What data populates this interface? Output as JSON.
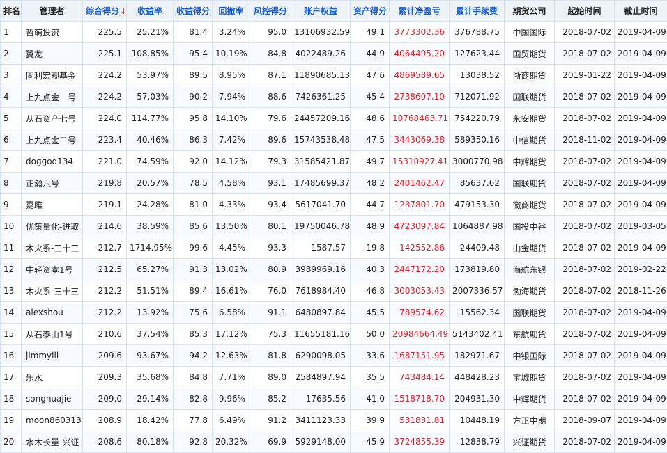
{
  "headers": [
    {
      "label": "排名",
      "sortable": false
    },
    {
      "label": "管理者",
      "sortable": false
    },
    {
      "label": "综合得分",
      "sortable": true,
      "sort_indicator": "↓"
    },
    {
      "label": "收益率",
      "sortable": true
    },
    {
      "label": "收益得分",
      "sortable": true
    },
    {
      "label": "回撤率",
      "sortable": true
    },
    {
      "label": "风控得分",
      "sortable": true
    },
    {
      "label": "账户权益",
      "sortable": true
    },
    {
      "label": "资产得分",
      "sortable": true
    },
    {
      "label": "累计净盈亏",
      "sortable": true
    },
    {
      "label": "累计手续费",
      "sortable": true
    },
    {
      "label": "期货公司",
      "sortable": false
    },
    {
      "label": "起始时间",
      "sortable": false
    },
    {
      "label": "截止时间",
      "sortable": false
    }
  ],
  "rows": [
    [
      "1",
      "哲萌投资",
      "225.5",
      "25.21%",
      "81.4",
      "3.24%",
      "95.0",
      "13106932.59",
      "49.1",
      "3773302.36",
      "376788.75",
      "中国国际",
      "2018-07-02",
      "2019-04-09"
    ],
    [
      "2",
      "翼龙",
      "225.1",
      "108.85%",
      "95.4",
      "10.19%",
      "84.8",
      "4022489.26",
      "44.9",
      "4064495.20",
      "127623.44",
      "国贸期货",
      "2018-07-02",
      "2019-04-09"
    ],
    [
      "3",
      "固利宏观基金",
      "224.2",
      "53.97%",
      "89.5",
      "8.95%",
      "87.1",
      "11890685.13",
      "47.6",
      "4869589.65",
      "13038.52",
      "浙商期货",
      "2019-01-22",
      "2019-04-09"
    ],
    [
      "4",
      "上九点金一号",
      "224.2",
      "57.03%",
      "90.2",
      "7.94%",
      "88.6",
      "7426361.25",
      "45.4",
      "2738697.10",
      "712071.92",
      "国联期货",
      "2018-07-02",
      "2019-04-09"
    ],
    [
      "5",
      "从石资产七号",
      "224.0",
      "114.77%",
      "95.8",
      "14.10%",
      "79.6",
      "24457209.16",
      "48.6",
      "10768463.71",
      "754220.79",
      "永安期货",
      "2018-07-02",
      "2019-04-09"
    ],
    [
      "6",
      "上九点金二号",
      "223.4",
      "40.46%",
      "86.3",
      "7.42%",
      "89.6",
      "15743538.48",
      "47.5",
      "3443069.38",
      "589350.16",
      "中信期货",
      "2018-11-02",
      "2019-04-09"
    ],
    [
      "7",
      "doggod134",
      "221.0",
      "74.59%",
      "92.0",
      "14.12%",
      "79.3",
      "31585421.87",
      "49.7",
      "15310927.41",
      "3000770.98",
      "中辉期货",
      "2018-07-02",
      "2019-04-09"
    ],
    [
      "8",
      "正瀚六号",
      "219.8",
      "20.57%",
      "78.5",
      "4.58%",
      "93.1",
      "17485699.37",
      "48.2",
      "2401462.47",
      "85637.62",
      "国联期货",
      "2018-07-02",
      "2019-04-09"
    ],
    [
      "9",
      "嘉雎",
      "219.1",
      "24.28%",
      "81.0",
      "4.33%",
      "93.4",
      "5617041.70",
      "44.7",
      "1237801.70",
      "479153.30",
      "徽商期货",
      "2018-07-02",
      "2019-04-09"
    ],
    [
      "10",
      "优策量化-进取",
      "214.6",
      "38.59%",
      "85.6",
      "13.50%",
      "80.1",
      "19750046.78",
      "48.9",
      "4723097.84",
      "1064887.98",
      "国投中谷",
      "2018-07-02",
      "2019-03-05"
    ],
    [
      "11",
      "木火系-三十三",
      "212.7",
      "1714.95%",
      "99.6",
      "4.45%",
      "93.3",
      "1587.57",
      "19.8",
      "142552.86",
      "24409.48",
      "山金期货",
      "2018-07-02",
      "2019-04-09"
    ],
    [
      "12",
      "中轻资本1号",
      "212.5",
      "65.27%",
      "91.3",
      "13.02%",
      "80.9",
      "3989969.16",
      "40.3",
      "2447172.20",
      "173819.80",
      "海航东银",
      "2018-07-02",
      "2019-02-22"
    ],
    [
      "13",
      "木火系-三十三",
      "212.2",
      "51.51%",
      "89.4",
      "16.61%",
      "76.0",
      "7618984.40",
      "46.8",
      "3003053.43",
      "2007336.57",
      "渤海期货",
      "2018-07-02",
      "2018-11-26"
    ],
    [
      "14",
      "alexshou",
      "212.2",
      "13.92%",
      "75.6",
      "6.58%",
      "91.1",
      "6480897.84",
      "45.5",
      "789574.62",
      "15562.34",
      "国联期货",
      "2018-07-02",
      "2019-04-09"
    ],
    [
      "15",
      "从石泰山1号",
      "210.6",
      "37.54%",
      "85.3",
      "17.12%",
      "75.3",
      "11655181.16",
      "50.0",
      "20984664.49",
      "5143402.41",
      "东航期货",
      "2018-07-02",
      "2019-04-09"
    ],
    [
      "16",
      "jimmyiii",
      "209.6",
      "93.67%",
      "94.2",
      "12.63%",
      "81.8",
      "6290098.05",
      "33.6",
      "1687151.95",
      "182971.67",
      "中银国际",
      "2018-07-02",
      "2019-04-09"
    ],
    [
      "17",
      "乐水",
      "209.3",
      "35.68%",
      "84.8",
      "7.71%",
      "89.0",
      "2584897.94",
      "35.5",
      "743484.14",
      "448428.23",
      "宝城期货",
      "2018-07-02",
      "2019-04-09"
    ],
    [
      "18",
      "songhuajie",
      "209.0",
      "29.14%",
      "82.8",
      "9.96%",
      "85.2",
      "17635.56",
      "41.0",
      "1518718.70",
      "204931.30",
      "中辉期货",
      "2018-07-02",
      "2019-04-09"
    ],
    [
      "19",
      "moon860313",
      "208.9",
      "18.42%",
      "77.8",
      "6.49%",
      "91.2",
      "3411123.33",
      "39.9",
      "531831.81",
      "10448.19",
      "方正中期",
      "2018-09-07",
      "2019-04-09"
    ],
    [
      "20",
      "水木长量-兴证",
      "208.6",
      "80.18%",
      "92.8",
      "20.32%",
      "69.9",
      "5929148.00",
      "45.9",
      "3724855.39",
      "12838.79",
      "兴证期货",
      "2018-07-02",
      "2019-04-09"
    ]
  ],
  "colors": {
    "link": "#1a5fd0",
    "profit": "#e0202a",
    "header_bg": "#eef3f8",
    "border": "#d9e4ef"
  }
}
